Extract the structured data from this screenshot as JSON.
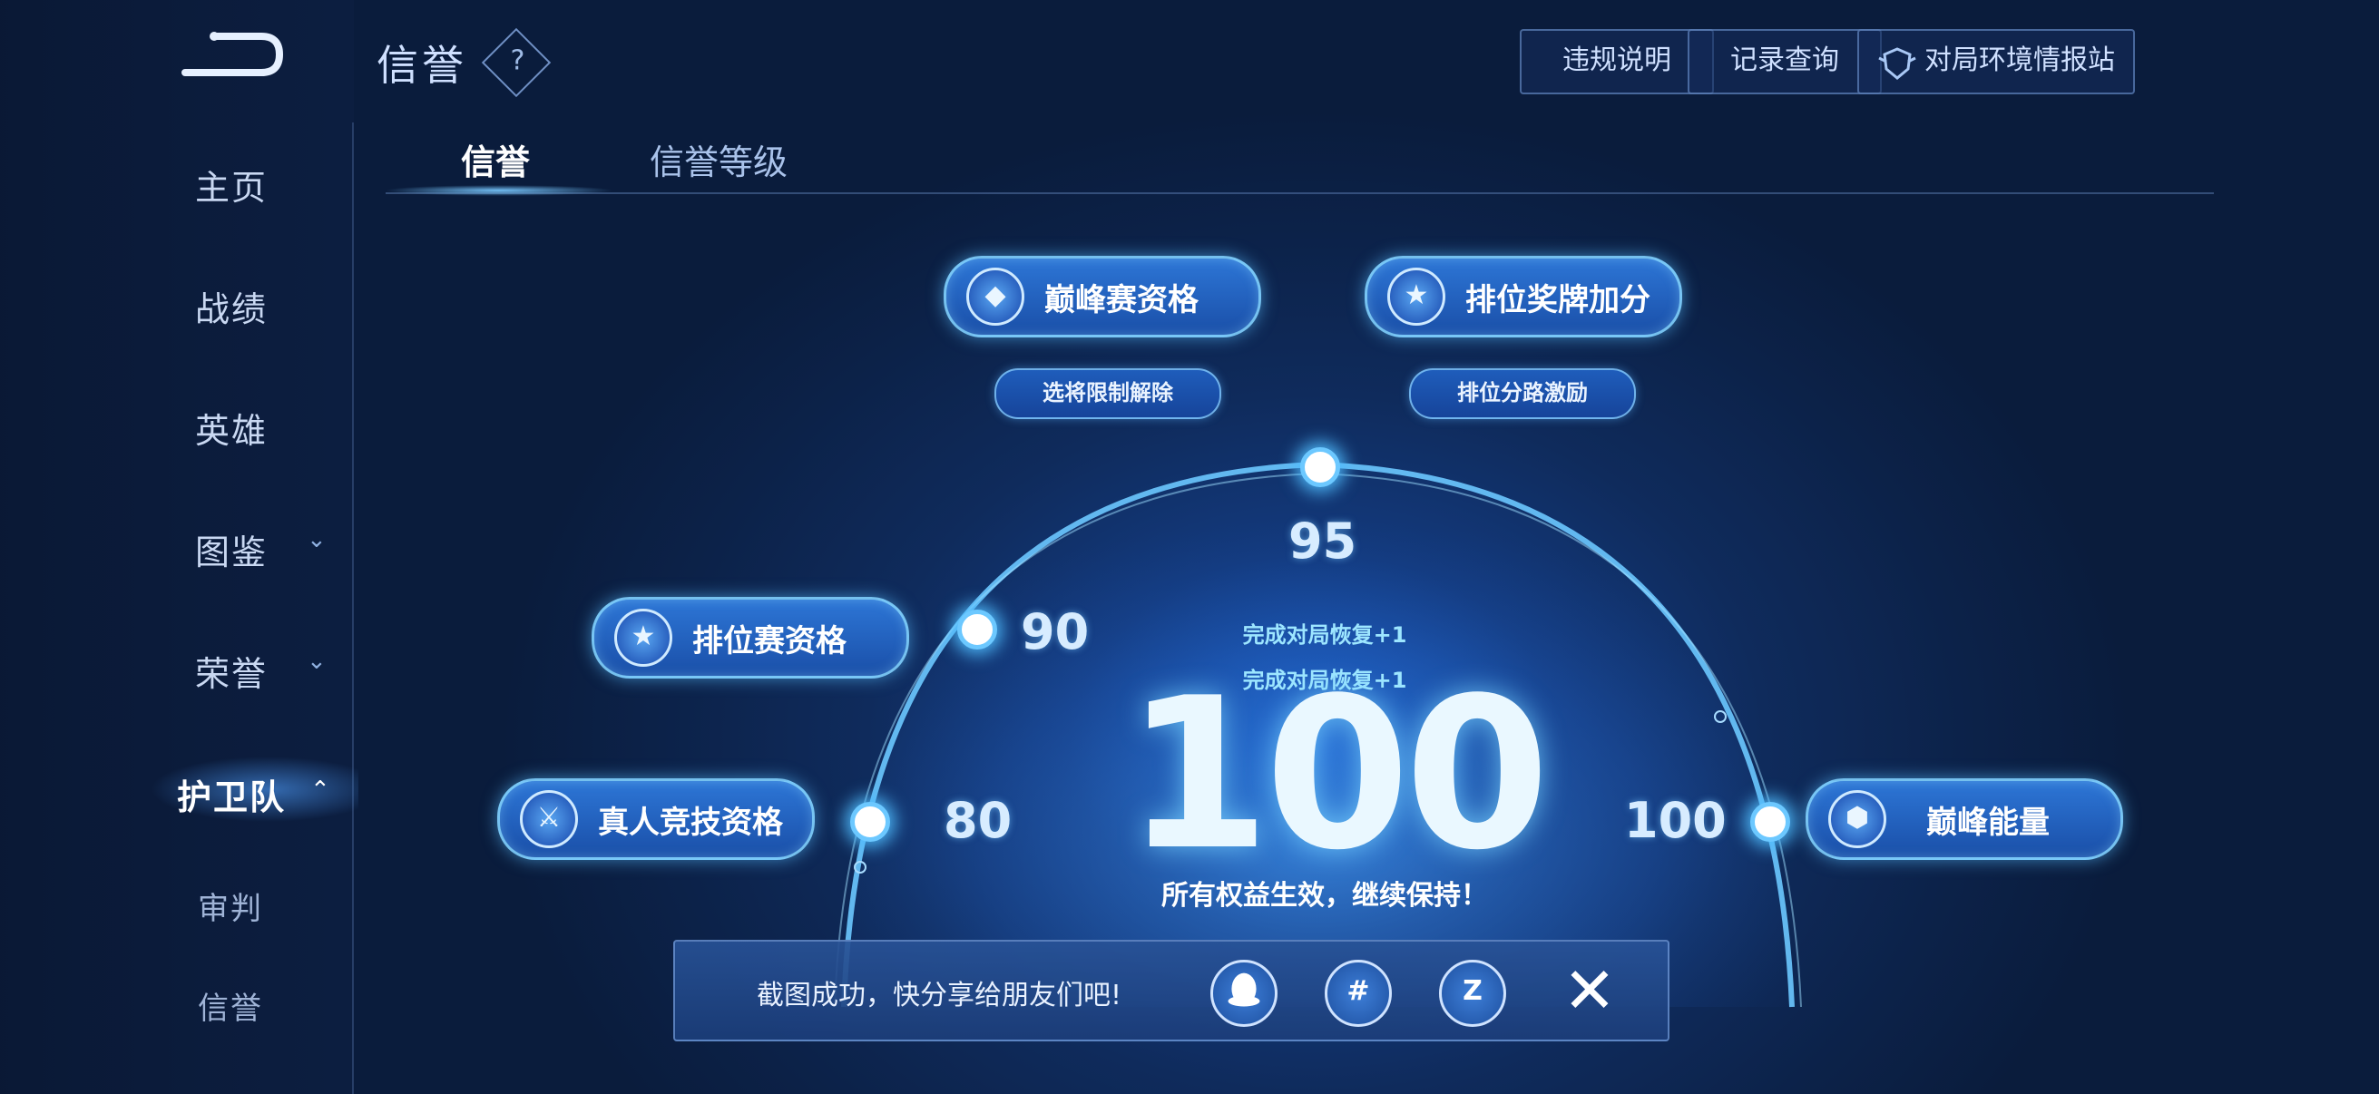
{
  "header": {
    "title": "信誉",
    "help_icon": "?",
    "buttons": [
      "违规说明",
      "记录查询",
      "对局环境情报站"
    ]
  },
  "sidebar": {
    "items": [
      {
        "label": "主页"
      },
      {
        "label": "战绩"
      },
      {
        "label": "英雄"
      },
      {
        "label": "图鉴",
        "chevron": "⌄"
      },
      {
        "label": "荣誉",
        "chevron": "⌄"
      },
      {
        "label": "护卫队",
        "chevron": "⌃",
        "active": true
      },
      {
        "label": "审判"
      },
      {
        "label": "信誉"
      }
    ]
  },
  "tabs": [
    {
      "label": "信誉",
      "active": true
    },
    {
      "label": "信誉等级"
    }
  ],
  "perks": {
    "peak_match": "巅峰赛资格",
    "peak_match_sub": "选将限制解除",
    "rank_medal": "排位奖牌加分",
    "rank_medal_sub": "排位分路激励",
    "ranked_match": "排位赛资格",
    "real_match": "真人竞技资格",
    "peak_energy": "巅峰能量"
  },
  "thresholds": {
    "t80": "80",
    "t90": "90",
    "t95": "95",
    "t100": "100"
  },
  "score": {
    "value": "100",
    "status": "所有权益生效，继续保持！",
    "recover_1": "完成对局恢复+1",
    "recover_2": "完成对局恢复+1"
  },
  "toast": {
    "message": "截图成功，快分享给朋友们吧!",
    "close": "✕"
  },
  "colors": {
    "accent": "#6cc8ff",
    "pill": "#2d76d6",
    "background": "#0f2b5c"
  }
}
